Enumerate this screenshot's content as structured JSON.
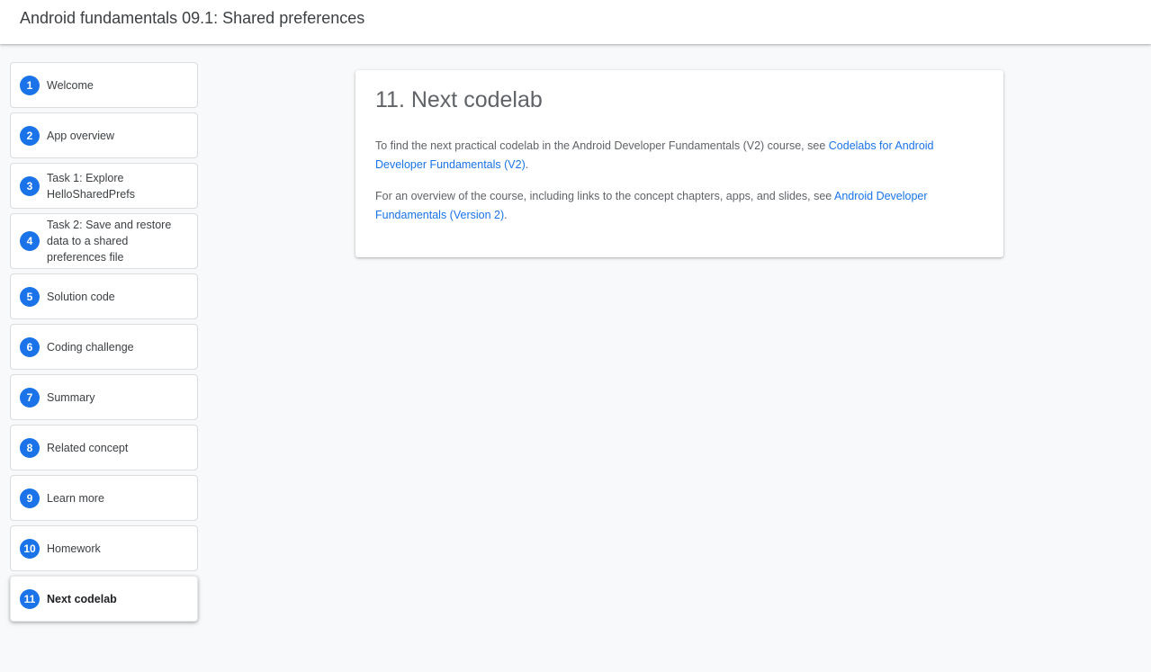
{
  "header": {
    "title": "Android fundamentals 09.1: Shared preferences"
  },
  "steps": [
    {
      "number": "1",
      "label": "Welcome"
    },
    {
      "number": "2",
      "label": "App overview"
    },
    {
      "number": "3",
      "label": "Task 1: Explore HelloSharedPrefs"
    },
    {
      "number": "4",
      "label": "Task 2: Save and restore data to a shared preferences file"
    },
    {
      "number": "5",
      "label": "Solution code"
    },
    {
      "number": "6",
      "label": "Coding challenge"
    },
    {
      "number": "7",
      "label": "Summary"
    },
    {
      "number": "8",
      "label": "Related concept"
    },
    {
      "number": "9",
      "label": "Learn more"
    },
    {
      "number": "10",
      "label": "Homework"
    },
    {
      "number": "11",
      "label": "Next codelab"
    }
  ],
  "selected_step": "11",
  "content": {
    "heading": "11. Next codelab",
    "p1_text": "To find the next practical codelab in the Android Developer Fundamentals (V2) course, see ",
    "p1_link": "Codelabs for Android Developer Fundamentals (V2)",
    "p1_end": ".",
    "p2_text": "For an overview of the course, including links to the concept chapters, apps, and slides, see ",
    "p2_link": "Android Developer Fundamentals (Version 2)",
    "p2_end": "."
  },
  "colors": {
    "accent": "#1a73e8",
    "background": "#f8f9fa"
  }
}
